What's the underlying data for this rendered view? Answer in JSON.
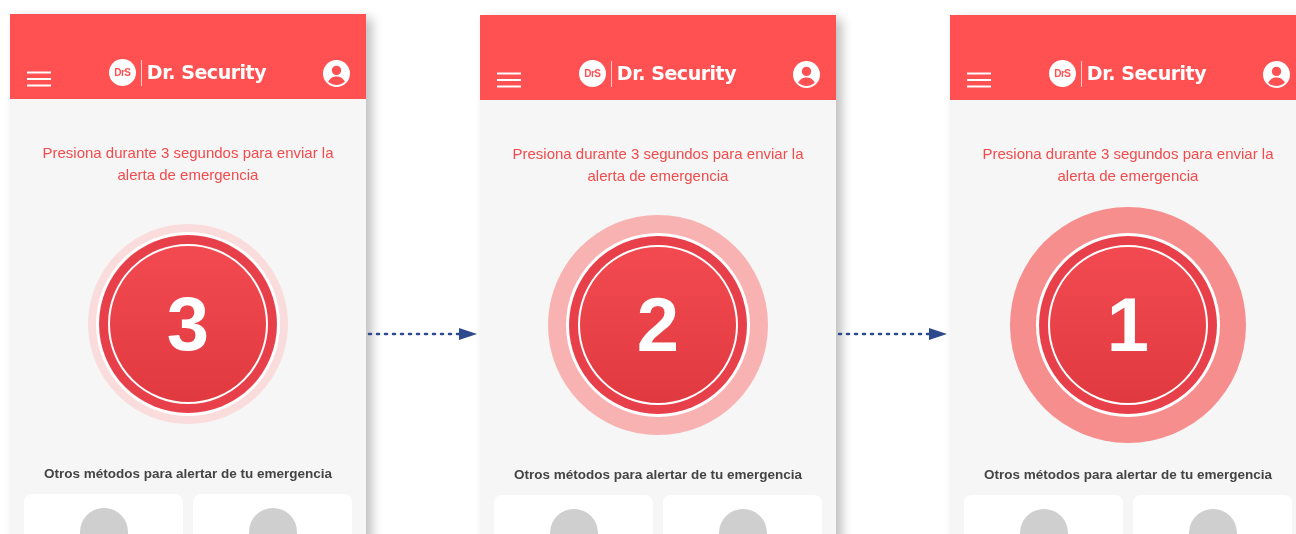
{
  "screens": [
    {
      "app_title": "Dr. Security",
      "logo_text": "DrS",
      "instruction": "Presiona durante 3 segundos para enviar la alerta de emergencia",
      "countdown": "3",
      "kind": "ring",
      "other_methods_title": "Otros métodos para alertar de tu emergencia"
    },
    {
      "app_title": "Dr. Security",
      "logo_text": "DrS",
      "instruction": "Presiona durante 3 segundos para enviar la alerta de emergencia",
      "countdown": "2",
      "kind": "soft",
      "other_methods_title": "Otros métodos para alertar de tu emergencia"
    },
    {
      "app_title": "Dr. Security",
      "logo_text": "DrS",
      "instruction": "Presiona durante 3 segundos para enviar la alerta de emergencia",
      "countdown": "1",
      "kind": "strong",
      "other_methods_title": "Otros métodos para alertar de tu emergencia"
    }
  ]
}
